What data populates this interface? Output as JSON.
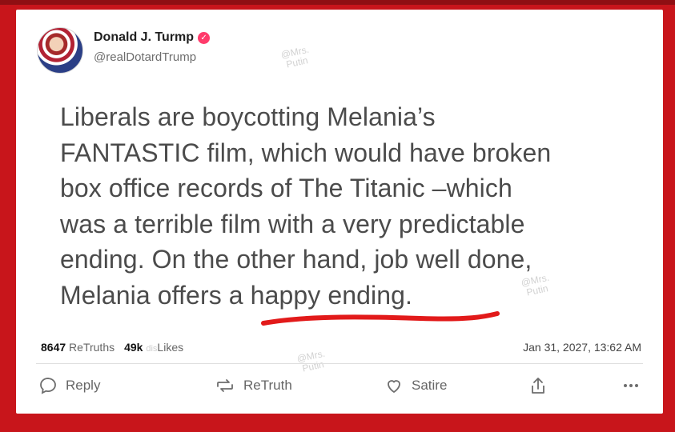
{
  "profile": {
    "display_name": "Donald J. Turmp",
    "handle": "@realDotardTrump",
    "verified_icon": "verified-badge-icon"
  },
  "post": {
    "lines": [
      "Liberals are boycotting Melania’s",
      "FANTASTIC film, which would have broken",
      "box office records of The Titanic –which",
      "was a terrible film with a very predictable",
      "ending. On the other hand, job well done,",
      "Melania offers a happy ending."
    ]
  },
  "watermarks": [
    "@Mrs.",
    "Putin"
  ],
  "stats": {
    "retruths_count": "8647",
    "retruths_label": "ReTruths",
    "likes_count": "49k",
    "dislikes_prefix": "dis",
    "likes_label": "Likes",
    "date": "Jan 31, 2027, 13:62 AM"
  },
  "actions": {
    "reply": "Reply",
    "retruth": "ReTruth",
    "satire": "Satire",
    "more_icon": "more-icon",
    "share_icon": "share-icon"
  },
  "colors": {
    "frame_red": "#c8151b",
    "underline_red": "#e21a1a",
    "text_gray": "#4b4b4b"
  }
}
